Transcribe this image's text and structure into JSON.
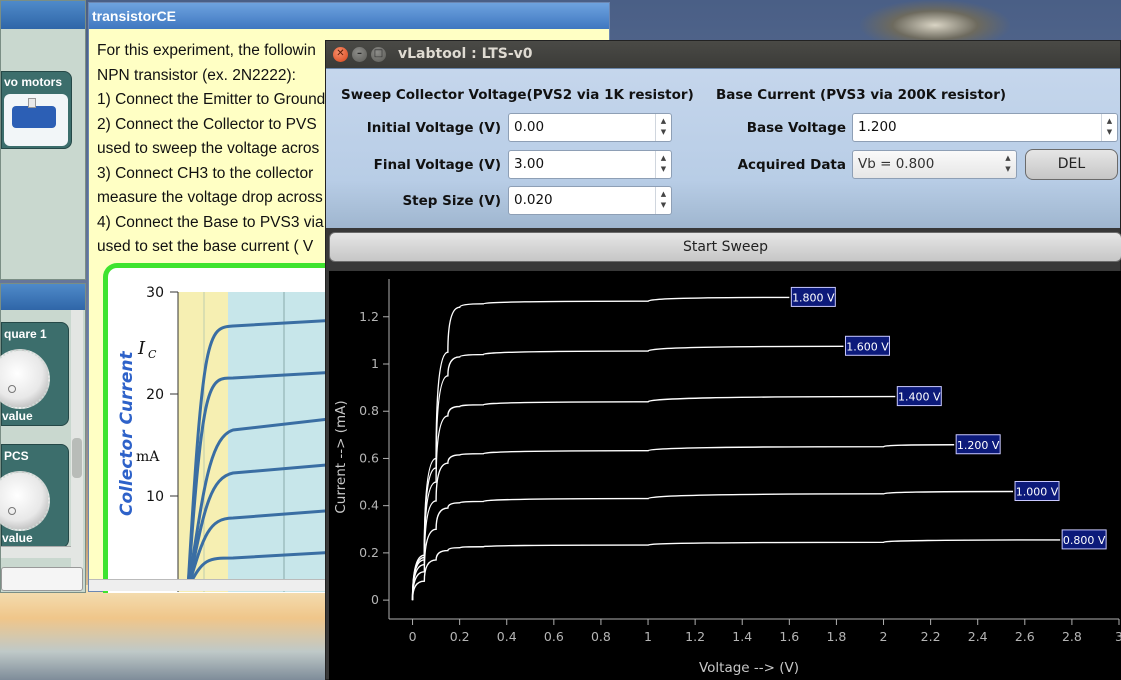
{
  "background": {
    "left_top_panel": {
      "servo_tile_label": "vo motors"
    },
    "left_bottom_panel": {
      "knobs": [
        {
          "title": "quare 1",
          "value_label": "value"
        },
        {
          "title": "PCS",
          "value_label": "value"
        }
      ]
    }
  },
  "doc_window": {
    "title": "transistorCE",
    "lines": [
      "For this experiment, the followin",
      "NPN transistor (ex. 2N2222):",
      "1) Connect the Emitter to Ground",
      "2) Connect the Collector to PVS",
      "used to sweep the voltage acros",
      "3) Connect CH3 to the collector",
      "measure the voltage drop across",
      "4) Connect the Base to PVS3 via",
      "used to set the base current ( V"
    ],
    "figure": {
      "y_axis_title": "Collector Current",
      "ic_label": "I",
      "ic_subscript": "C",
      "unit": "mA",
      "ticks": [
        "30",
        "20",
        "10"
      ]
    }
  },
  "main_window": {
    "title": "vLabtool : LTS-v0",
    "sweep_section": {
      "heading": "Sweep Collector Voltage(PVS2 via 1K resistor)",
      "initial_label": "Initial Voltage (V)",
      "initial_value": "0.00",
      "final_label": "Final Voltage (V)",
      "final_value": "3.00",
      "step_label": "Step Size (V)",
      "step_value": "0.020"
    },
    "base_section": {
      "heading": "Base Current (PVS3 via 200K resistor)",
      "base_voltage_label": "Base Voltage",
      "base_voltage_value": "1.200",
      "acquired_label": "Acquired Data",
      "acquired_selected": "Vb = 0.800",
      "delete_label": "DEL"
    },
    "start_sweep_label": "Start Sweep"
  },
  "chart_data": {
    "type": "line",
    "title": "",
    "xlabel": "Voltage --> (V)",
    "ylabel": "Current --> (mA)",
    "xlim": [
      -0.1,
      3.0
    ],
    "ylim": [
      -0.08,
      1.36
    ],
    "xticks": [
      "0",
      "0.2",
      "0.4",
      "0.6",
      "0.8",
      "1",
      "1.2",
      "1.4",
      "1.6",
      "1.8",
      "2",
      "2.2",
      "2.4",
      "2.6",
      "2.8",
      "3"
    ],
    "yticks": [
      "0",
      "0.2",
      "0.4",
      "0.6",
      "0.8",
      "1",
      "1.2"
    ],
    "grid": false,
    "background": "#000000",
    "line_color": "#ffffff",
    "label_color": "#0c1a7a",
    "series": [
      {
        "name": "0.800 V",
        "end_x": 2.75,
        "values": [
          [
            0,
            0
          ],
          [
            0.05,
            0.08
          ],
          [
            0.1,
            0.17
          ],
          [
            0.15,
            0.21
          ],
          [
            0.2,
            0.222
          ],
          [
            0.3,
            0.226
          ],
          [
            1.0,
            0.233
          ],
          [
            2.0,
            0.245
          ],
          [
            2.75,
            0.255
          ]
        ]
      },
      {
        "name": "1.000 V",
        "end_x": 2.55,
        "values": [
          [
            0,
            0
          ],
          [
            0.05,
            0.12
          ],
          [
            0.1,
            0.3
          ],
          [
            0.15,
            0.39
          ],
          [
            0.2,
            0.412
          ],
          [
            0.3,
            0.418
          ],
          [
            1.0,
            0.43
          ],
          [
            2.0,
            0.45
          ],
          [
            2.55,
            0.46
          ]
        ]
      },
      {
        "name": "1.200 V",
        "end_x": 2.3,
        "values": [
          [
            0,
            0
          ],
          [
            0.05,
            0.15
          ],
          [
            0.1,
            0.42
          ],
          [
            0.15,
            0.58
          ],
          [
            0.2,
            0.615
          ],
          [
            0.3,
            0.62
          ],
          [
            1.0,
            0.633
          ],
          [
            2.0,
            0.65
          ],
          [
            2.3,
            0.658
          ]
        ]
      },
      {
        "name": "1.400 V",
        "end_x": 2.05,
        "values": [
          [
            0,
            0
          ],
          [
            0.05,
            0.17
          ],
          [
            0.1,
            0.5
          ],
          [
            0.15,
            0.78
          ],
          [
            0.2,
            0.82
          ],
          [
            0.3,
            0.827
          ],
          [
            1.0,
            0.84
          ],
          [
            2.05,
            0.862
          ]
        ]
      },
      {
        "name": "1.600 V",
        "end_x": 1.83,
        "values": [
          [
            0,
            0
          ],
          [
            0.05,
            0.18
          ],
          [
            0.1,
            0.56
          ],
          [
            0.15,
            0.95
          ],
          [
            0.2,
            1.03
          ],
          [
            0.3,
            1.04
          ],
          [
            1.0,
            1.055
          ],
          [
            1.83,
            1.075
          ]
        ]
      },
      {
        "name": "1.800 V",
        "end_x": 1.6,
        "values": [
          [
            0,
            0
          ],
          [
            0.05,
            0.19
          ],
          [
            0.1,
            0.6
          ],
          [
            0.15,
            1.05
          ],
          [
            0.2,
            1.24
          ],
          [
            0.3,
            1.255
          ],
          [
            1.0,
            1.266
          ],
          [
            1.6,
            1.282
          ]
        ]
      }
    ]
  }
}
